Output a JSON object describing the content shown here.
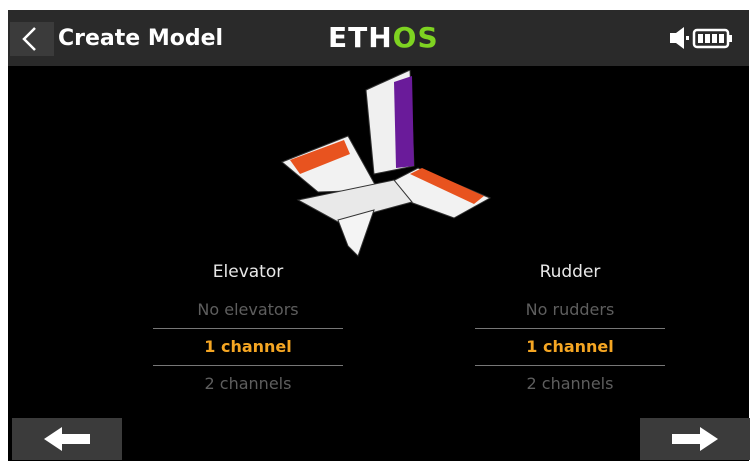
{
  "header": {
    "title": "Create Model",
    "logo_main": "ETH",
    "logo_accent": "OS"
  },
  "colors": {
    "accent_selected": "#f5a623",
    "logo_accent": "#7ed321",
    "rudder_highlight": "#6a1b9a",
    "elevator_highlight": "#e8531f"
  },
  "icons": {
    "back": "chevron-left-icon",
    "speaker": "speaker-icon",
    "battery": "battery-icon",
    "prev": "arrow-left-icon",
    "next": "arrow-right-icon"
  },
  "elevator": {
    "label": "Elevator",
    "options": [
      "No elevators",
      "1 channel",
      "2 channels"
    ],
    "selected": "1 channel"
  },
  "rudder": {
    "label": "Rudder",
    "options": [
      "No rudders",
      "1 channel",
      "2 channels"
    ],
    "selected": "1 channel"
  }
}
